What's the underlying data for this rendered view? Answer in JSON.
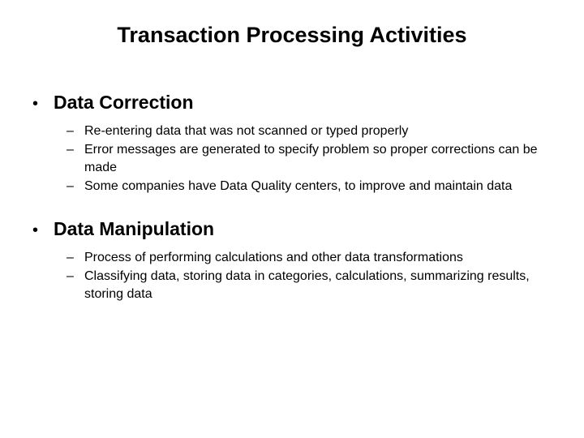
{
  "title": "Transaction Processing Activities",
  "sections": [
    {
      "label": "Data Correction",
      "items": [
        "Re-entering data that was not scanned or typed properly",
        "Error messages are generated to specify problem so proper corrections can be made",
        "Some companies have Data Quality centers, to improve and maintain data"
      ]
    },
    {
      "label": "Data Manipulation",
      "items": [
        "Process of performing calculations and other data transformations",
        "Classifying data, storing data in categories, calculations, summarizing results, storing data"
      ]
    }
  ]
}
